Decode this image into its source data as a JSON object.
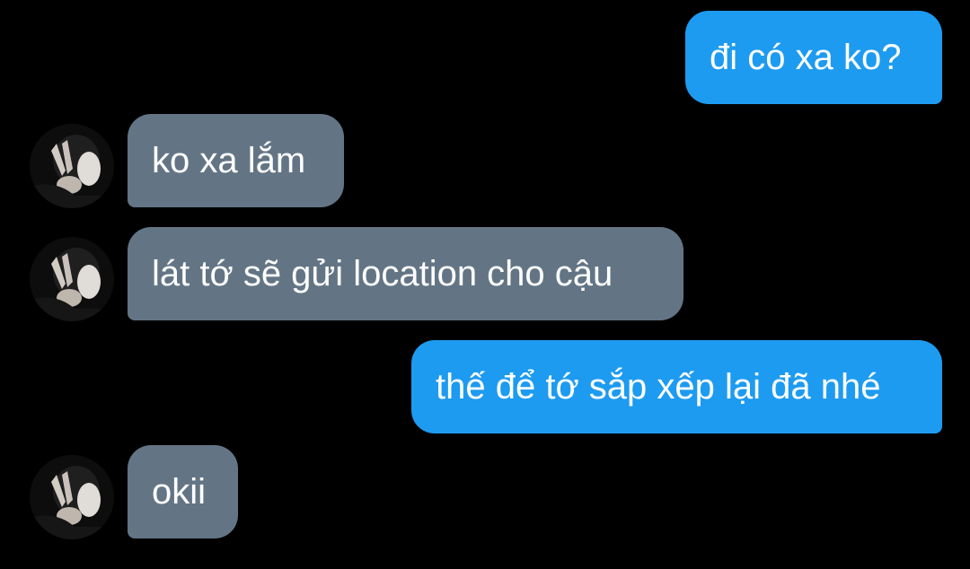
{
  "conversation": {
    "messages": [
      {
        "sender": "me",
        "text": "đi có xa ko?"
      },
      {
        "sender": "contact",
        "text": "ko xa lắm",
        "avatar_icon": "contact-avatar"
      },
      {
        "sender": "contact",
        "text": "lát tớ sẽ gửi location cho cậu",
        "avatar_icon": "contact-avatar"
      },
      {
        "sender": "me",
        "text": "thế để tớ sắp xếp lại đã nhé"
      },
      {
        "sender": "contact",
        "text": "okii",
        "avatar_icon": "contact-avatar"
      }
    ]
  },
  "colors": {
    "background": "#000000",
    "outgoing_bubble": "#1d9bf0",
    "incoming_bubble": "#637585",
    "text": "#ffffff"
  }
}
